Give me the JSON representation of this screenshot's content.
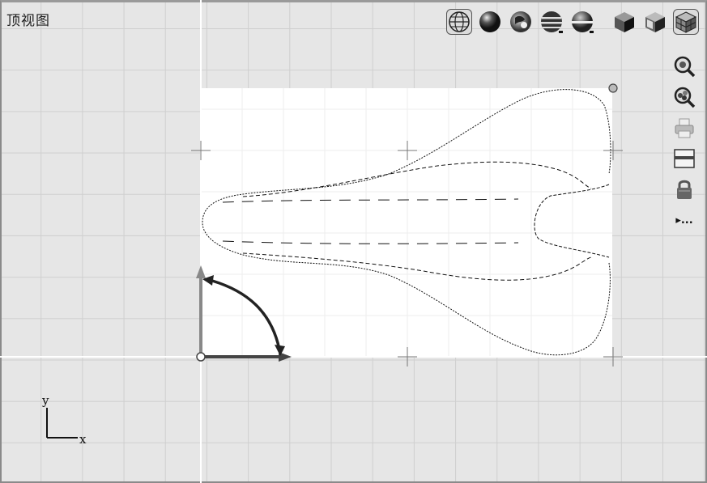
{
  "viewport": {
    "title": "顶视图"
  },
  "toolbar": {
    "buttons": [
      {
        "name": "wireframe-globe-icon"
      },
      {
        "name": "shaded-sphere-icon"
      },
      {
        "name": "render-sphere-icon"
      },
      {
        "name": "striped-sphere-icon"
      },
      {
        "name": "half-sphere-icon"
      },
      {
        "name": "solid-cube-icon"
      },
      {
        "name": "shaded-cube-icon"
      },
      {
        "name": "wire-cube-icon",
        "active": true
      }
    ]
  },
  "sidebar": {
    "buttons": [
      {
        "name": "zoom-icon"
      },
      {
        "name": "zoom-extents-icon"
      },
      {
        "name": "print-icon"
      },
      {
        "name": "section-icon"
      },
      {
        "name": "lock-icon"
      }
    ],
    "more_label": "▸..."
  },
  "axis_triad": {
    "y_label": "y",
    "x_label": "x"
  },
  "colors": {
    "background": "#e6e6e6",
    "grid": "#cfcfcf",
    "axis_line": "#ffffff",
    "outline": "#111111"
  }
}
